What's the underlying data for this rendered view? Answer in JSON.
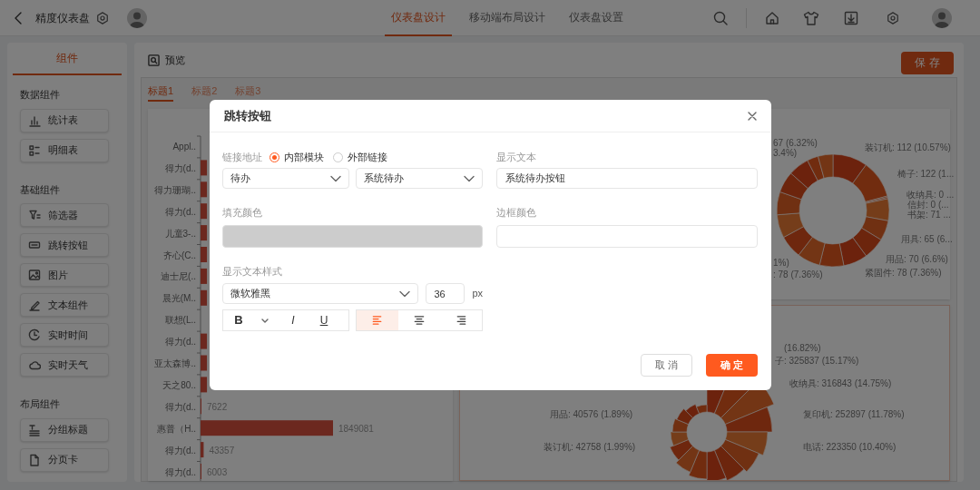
{
  "header": {
    "title": "精度仪表盘",
    "tabs": [
      {
        "label": "仪表盘设计",
        "selected": true
      },
      {
        "label": "移动端布局设计",
        "selected": false
      },
      {
        "label": "仪表盘设置",
        "selected": false
      }
    ]
  },
  "sidebar": {
    "tab": "组件",
    "groups": [
      {
        "title": "数据组件",
        "items": [
          {
            "label": "统计表",
            "kind": "bars"
          },
          {
            "label": "明细表",
            "kind": "list"
          }
        ]
      },
      {
        "title": "基础组件",
        "items": [
          {
            "label": "筛选器",
            "kind": "filter"
          },
          {
            "label": "跳转按钮",
            "kind": "button"
          },
          {
            "label": "图片",
            "kind": "image"
          },
          {
            "label": "文本组件",
            "kind": "pen"
          },
          {
            "label": "实时时间",
            "kind": "clock"
          },
          {
            "label": "实时天气",
            "kind": "cloud"
          }
        ]
      },
      {
        "title": "布局组件",
        "items": [
          {
            "label": "分组标题",
            "kind": "heading"
          },
          {
            "label": "分页卡",
            "kind": "page"
          }
        ]
      }
    ]
  },
  "toolbar": {
    "preview": "预览",
    "save": "保 存"
  },
  "canvas_tabs": [
    {
      "label": "标题1",
      "selected": true
    },
    {
      "label": "标题2",
      "selected": false
    },
    {
      "label": "标题3",
      "selected": false
    }
  ],
  "bar_chart": {
    "chart_data": {
      "type": "bar",
      "orientation": "horizontal",
      "categories": [
        "Appl..",
        "得力(d..",
        "得力珊瑚..",
        "得力(d..",
        "儿童3-..",
        "齐心(C..",
        "迪士尼(..",
        "晨光(M..",
        "联想(L..",
        "得力(d..",
        "亚太森博..",
        "天之80..",
        "得力(d..",
        "惠普（H..",
        "得力(d..",
        "得力(d.."
      ],
      "values": [
        null,
        90000,
        90000,
        90000,
        90000,
        90000,
        90000,
        90000,
        null,
        90000,
        90000,
        90000,
        7622,
        1849081,
        43357,
        6003
      ],
      "value_labels": [
        null,
        null,
        null,
        null,
        null,
        null,
        null,
        null,
        null,
        null,
        null,
        null,
        "7622",
        "1849081",
        "43357",
        "6003"
      ]
    }
  },
  "donut_chart": {
    "labels": [
      "67 (6.32%)",
      "3.4%)",
      "装订机: 112 (10.57%)",
      "椅子: 122 (1...",
      "收纳具: 0 ...",
      "信封: 0 (...",
      "书架: 71 ...",
      "用具: 65 (6...",
      "用品: 70 (6.6%)",
      "紧固件: 78 (7.36%)",
      "1%)",
      ": 78 (7.36%)"
    ]
  },
  "rose_chart": {
    "labels": [
      "(16.82%)",
      "子: 325837 (15.17%)",
      "收纳具: 316843 (14.75%)",
      "复印机: 252897 (11.78%)",
      "电话: 223350 (10.40%)",
      "用品: 40576 (1.89%)",
      "装订机: 42758 (1.99%)"
    ]
  },
  "dialog": {
    "title": "跳转按钮",
    "link_label": "链接地址",
    "link_options": [
      {
        "label": "内部模块",
        "selected": true
      },
      {
        "label": "外部链接",
        "selected": false
      }
    ],
    "module_select": "待办",
    "page_select": "系统待办",
    "display_text_label": "显示文本",
    "display_text": "系统待办按钮",
    "fill_color_label": "填充颜色",
    "border_color_label": "边框颜色",
    "text_style_label": "显示文本样式",
    "font": "微软雅黑",
    "font_size": "36",
    "unit": "px",
    "format_buttons": [
      {
        "label": "B",
        "kind": "bold"
      },
      {
        "label": "I",
        "kind": "italic"
      },
      {
        "label": "U",
        "kind": "underline"
      }
    ],
    "align_buttons": [
      {
        "kind": "left",
        "selected": true
      },
      {
        "kind": "center",
        "selected": false
      },
      {
        "kind": "right",
        "selected": false
      }
    ],
    "cancel": "取 消",
    "confirm": "确 定"
  }
}
